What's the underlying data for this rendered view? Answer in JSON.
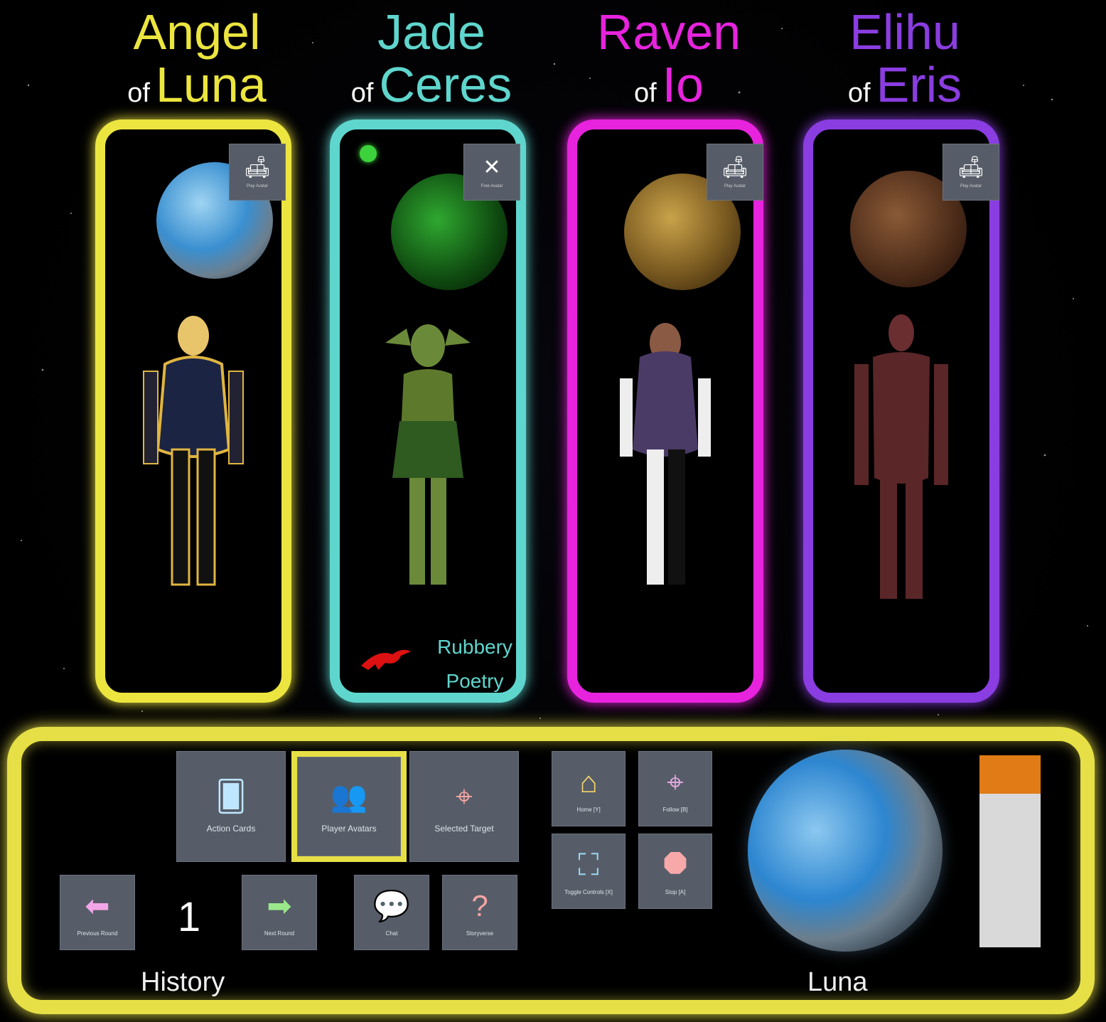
{
  "players": [
    {
      "name": "Angel",
      "of": "of",
      "planet": "Luna",
      "color": "#ece53f",
      "button": "Play Avatar",
      "icon": "armchair-icon"
    },
    {
      "name": "Jade",
      "of": "of",
      "planet": "Ceres",
      "color": "#5fd6cd",
      "button": "Free Avatar",
      "icon": "close-icon",
      "annotation": [
        "Rubbery",
        "Poetry"
      ]
    },
    {
      "name": "Raven",
      "of": "of",
      "planet": "Io",
      "color": "#e723de",
      "button": "Play Avatar",
      "icon": "armchair-icon"
    },
    {
      "name": "Elihu",
      "of": "of",
      "planet": "Eris",
      "color": "#8a3de0",
      "button": "Play Avatar",
      "icon": "armchair-icon"
    }
  ],
  "controls": {
    "action_cards": "Action Cards",
    "player_avatars": "Player Avatars",
    "selected_target": "Selected Target",
    "previous_round": "Previous Round",
    "round_number": "1",
    "next_round": "Next Round",
    "chat": "Chat",
    "storyverse": "Storyverse",
    "home": "Home [Y]",
    "follow": "Follow [B]",
    "toggle_controls": "Toggle Controls [X]",
    "stop": "Stop [A]",
    "history_label": "History",
    "current_planet": "Luna"
  },
  "colors": {
    "panel_border": "#e6df46",
    "meter_fill": "#e07b16",
    "meter_bg": "#d9d9d9"
  },
  "meter": {
    "fill_fraction": 0.2
  }
}
